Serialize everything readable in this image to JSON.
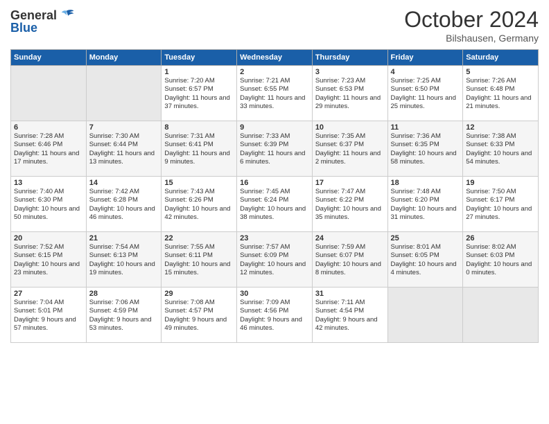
{
  "header": {
    "logo_line1": "General",
    "logo_line2": "Blue",
    "month": "October 2024",
    "location": "Bilshausen, Germany"
  },
  "days_of_week": [
    "Sunday",
    "Monday",
    "Tuesday",
    "Wednesday",
    "Thursday",
    "Friday",
    "Saturday"
  ],
  "weeks": [
    [
      {
        "day": "",
        "content": ""
      },
      {
        "day": "",
        "content": ""
      },
      {
        "day": "1",
        "content": "Sunrise: 7:20 AM\nSunset: 6:57 PM\nDaylight: 11 hours and 37 minutes."
      },
      {
        "day": "2",
        "content": "Sunrise: 7:21 AM\nSunset: 6:55 PM\nDaylight: 11 hours and 33 minutes."
      },
      {
        "day": "3",
        "content": "Sunrise: 7:23 AM\nSunset: 6:53 PM\nDaylight: 11 hours and 29 minutes."
      },
      {
        "day": "4",
        "content": "Sunrise: 7:25 AM\nSunset: 6:50 PM\nDaylight: 11 hours and 25 minutes."
      },
      {
        "day": "5",
        "content": "Sunrise: 7:26 AM\nSunset: 6:48 PM\nDaylight: 11 hours and 21 minutes."
      }
    ],
    [
      {
        "day": "6",
        "content": "Sunrise: 7:28 AM\nSunset: 6:46 PM\nDaylight: 11 hours and 17 minutes."
      },
      {
        "day": "7",
        "content": "Sunrise: 7:30 AM\nSunset: 6:44 PM\nDaylight: 11 hours and 13 minutes."
      },
      {
        "day": "8",
        "content": "Sunrise: 7:31 AM\nSunset: 6:41 PM\nDaylight: 11 hours and 9 minutes."
      },
      {
        "day": "9",
        "content": "Sunrise: 7:33 AM\nSunset: 6:39 PM\nDaylight: 11 hours and 6 minutes."
      },
      {
        "day": "10",
        "content": "Sunrise: 7:35 AM\nSunset: 6:37 PM\nDaylight: 11 hours and 2 minutes."
      },
      {
        "day": "11",
        "content": "Sunrise: 7:36 AM\nSunset: 6:35 PM\nDaylight: 10 hours and 58 minutes."
      },
      {
        "day": "12",
        "content": "Sunrise: 7:38 AM\nSunset: 6:33 PM\nDaylight: 10 hours and 54 minutes."
      }
    ],
    [
      {
        "day": "13",
        "content": "Sunrise: 7:40 AM\nSunset: 6:30 PM\nDaylight: 10 hours and 50 minutes."
      },
      {
        "day": "14",
        "content": "Sunrise: 7:42 AM\nSunset: 6:28 PM\nDaylight: 10 hours and 46 minutes."
      },
      {
        "day": "15",
        "content": "Sunrise: 7:43 AM\nSunset: 6:26 PM\nDaylight: 10 hours and 42 minutes."
      },
      {
        "day": "16",
        "content": "Sunrise: 7:45 AM\nSunset: 6:24 PM\nDaylight: 10 hours and 38 minutes."
      },
      {
        "day": "17",
        "content": "Sunrise: 7:47 AM\nSunset: 6:22 PM\nDaylight: 10 hours and 35 minutes."
      },
      {
        "day": "18",
        "content": "Sunrise: 7:48 AM\nSunset: 6:20 PM\nDaylight: 10 hours and 31 minutes."
      },
      {
        "day": "19",
        "content": "Sunrise: 7:50 AM\nSunset: 6:17 PM\nDaylight: 10 hours and 27 minutes."
      }
    ],
    [
      {
        "day": "20",
        "content": "Sunrise: 7:52 AM\nSunset: 6:15 PM\nDaylight: 10 hours and 23 minutes."
      },
      {
        "day": "21",
        "content": "Sunrise: 7:54 AM\nSunset: 6:13 PM\nDaylight: 10 hours and 19 minutes."
      },
      {
        "day": "22",
        "content": "Sunrise: 7:55 AM\nSunset: 6:11 PM\nDaylight: 10 hours and 15 minutes."
      },
      {
        "day": "23",
        "content": "Sunrise: 7:57 AM\nSunset: 6:09 PM\nDaylight: 10 hours and 12 minutes."
      },
      {
        "day": "24",
        "content": "Sunrise: 7:59 AM\nSunset: 6:07 PM\nDaylight: 10 hours and 8 minutes."
      },
      {
        "day": "25",
        "content": "Sunrise: 8:01 AM\nSunset: 6:05 PM\nDaylight: 10 hours and 4 minutes."
      },
      {
        "day": "26",
        "content": "Sunrise: 8:02 AM\nSunset: 6:03 PM\nDaylight: 10 hours and 0 minutes."
      }
    ],
    [
      {
        "day": "27",
        "content": "Sunrise: 7:04 AM\nSunset: 5:01 PM\nDaylight: 9 hours and 57 minutes."
      },
      {
        "day": "28",
        "content": "Sunrise: 7:06 AM\nSunset: 4:59 PM\nDaylight: 9 hours and 53 minutes."
      },
      {
        "day": "29",
        "content": "Sunrise: 7:08 AM\nSunset: 4:57 PM\nDaylight: 9 hours and 49 minutes."
      },
      {
        "day": "30",
        "content": "Sunrise: 7:09 AM\nSunset: 4:56 PM\nDaylight: 9 hours and 46 minutes."
      },
      {
        "day": "31",
        "content": "Sunrise: 7:11 AM\nSunset: 4:54 PM\nDaylight: 9 hours and 42 minutes."
      },
      {
        "day": "",
        "content": ""
      },
      {
        "day": "",
        "content": ""
      }
    ]
  ]
}
